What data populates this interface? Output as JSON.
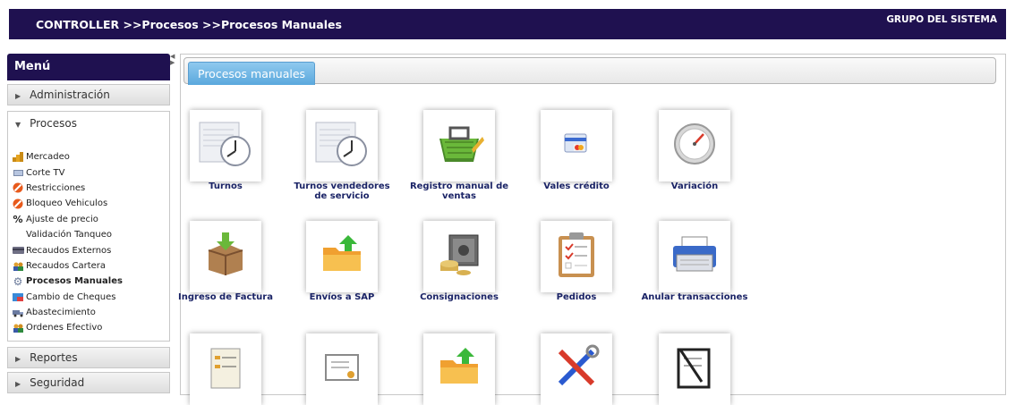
{
  "header": {
    "breadcrumb": "CONTROLLER >>Procesos >>Procesos Manuales",
    "group": "GRUPO DEL SISTEMA"
  },
  "menu": {
    "title": "Menú",
    "sections": {
      "administracion": "Administración",
      "procesos": "Procesos",
      "reportes": "Reportes",
      "seguridad": "Seguridad"
    },
    "items": [
      {
        "label": "Mercadeo",
        "icon": "bar-chart-icon"
      },
      {
        "label": "Corte TV",
        "icon": "tv-icon"
      },
      {
        "label": "Restricciones",
        "icon": "forbidden-icon"
      },
      {
        "label": "Bloqueo Vehiculos",
        "icon": "forbidden-icon"
      },
      {
        "label": "Ajuste de precio",
        "icon": "percent-icon"
      },
      {
        "label": "Validación Tanqueo",
        "icon": "blank-icon"
      },
      {
        "label": "Recaudos Externos",
        "icon": "card-icon"
      },
      {
        "label": "Recaudos Cartera",
        "icon": "people-icon"
      },
      {
        "label": "Procesos Manuales",
        "icon": "gear-icon"
      },
      {
        "label": "Cambio de Cheques",
        "icon": "cheque-icon"
      },
      {
        "label": "Abastecimiento",
        "icon": "truck-icon"
      },
      {
        "label": "Ordenes Efectivo",
        "icon": "people-icon"
      }
    ]
  },
  "panel": {
    "tab": "Procesos manuales",
    "tiles": [
      {
        "label": "Turnos",
        "icon": "clock-document-icon"
      },
      {
        "label": "Turnos vendedores de servicio",
        "icon": "clock-document-icon"
      },
      {
        "label": "Registro manual de ventas",
        "icon": "basket-icon"
      },
      {
        "label": "Vales crédito",
        "icon": "credit-card-icon"
      },
      {
        "label": "Variación",
        "icon": "gauge-icon"
      },
      {
        "label": "Ingreso de Factura",
        "icon": "box-download-icon"
      },
      {
        "label": "Envíos a SAP",
        "icon": "folder-upload-icon"
      },
      {
        "label": "Consignaciones",
        "icon": "safe-coins-icon"
      },
      {
        "label": "Pedidos",
        "icon": "clipboard-checklist-icon"
      },
      {
        "label": "Anular transacciones",
        "icon": "printer-icon"
      },
      {
        "label": "",
        "icon": "document-list-icon"
      },
      {
        "label": "",
        "icon": "certificate-icon"
      },
      {
        "label": "",
        "icon": "folder-upload-icon"
      },
      {
        "label": "",
        "icon": "tools-icon"
      },
      {
        "label": "",
        "icon": "pencil-clipboard-icon"
      }
    ]
  },
  "colors": {
    "header_bg": "#1f1150",
    "tab_bg": "#5aa8dd",
    "tile_label": "#1a2366"
  }
}
